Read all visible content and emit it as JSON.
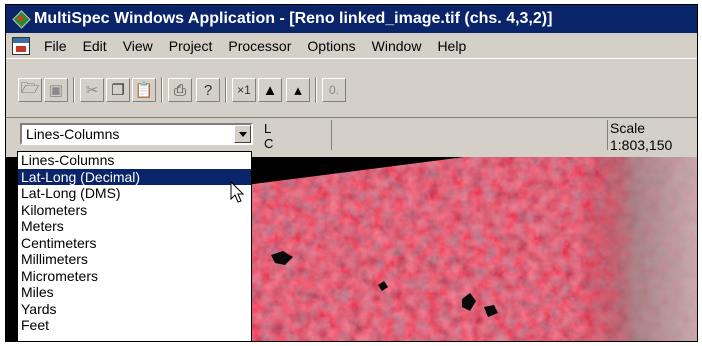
{
  "window": {
    "title": "MultiSpec Windows Application - [Reno linked_image.tif (chs. 4,3,2)]"
  },
  "menu": [
    "File",
    "Edit",
    "View",
    "Project",
    "Processor",
    "Options",
    "Window",
    "Help"
  ],
  "toolbar": {
    "buttons": [
      {
        "name": "open-icon",
        "glyph": "🗁"
      },
      {
        "name": "save-icon",
        "glyph": "▣"
      },
      {
        "name": "cut-icon",
        "glyph": "✂"
      },
      {
        "name": "copy-icon",
        "glyph": "❐"
      },
      {
        "name": "paste-icon",
        "glyph": "📋"
      },
      {
        "name": "print-icon",
        "glyph": "⎙"
      },
      {
        "name": "help-icon",
        "glyph": "?"
      },
      {
        "name": "zoom-x1-icon",
        "glyph": "×1"
      },
      {
        "name": "zoom-in-icon",
        "glyph": "▲"
      },
      {
        "name": "zoom-out-icon",
        "glyph": "▴"
      },
      {
        "name": "overlay-icon",
        "glyph": "0."
      }
    ]
  },
  "coordinates": {
    "unit_selected": "Lines-Columns",
    "line_label": "L",
    "column_label": "C",
    "scale_label": "Scale",
    "scale_value": "1:803,150"
  },
  "dropdown": {
    "options": [
      "Lines-Columns",
      "Lat-Long (Decimal)",
      "Lat-Long (DMS)",
      "Kilometers",
      "Meters",
      "Centimeters",
      "Millimeters",
      "Micrometers",
      "Miles",
      "Yards",
      "Feet"
    ],
    "highlighted_index": 1
  },
  "colors": {
    "titlebar": "#0a246a",
    "selection": "#0a246a",
    "chrome": "#d4d0c8",
    "image_red": "#b8102a"
  }
}
